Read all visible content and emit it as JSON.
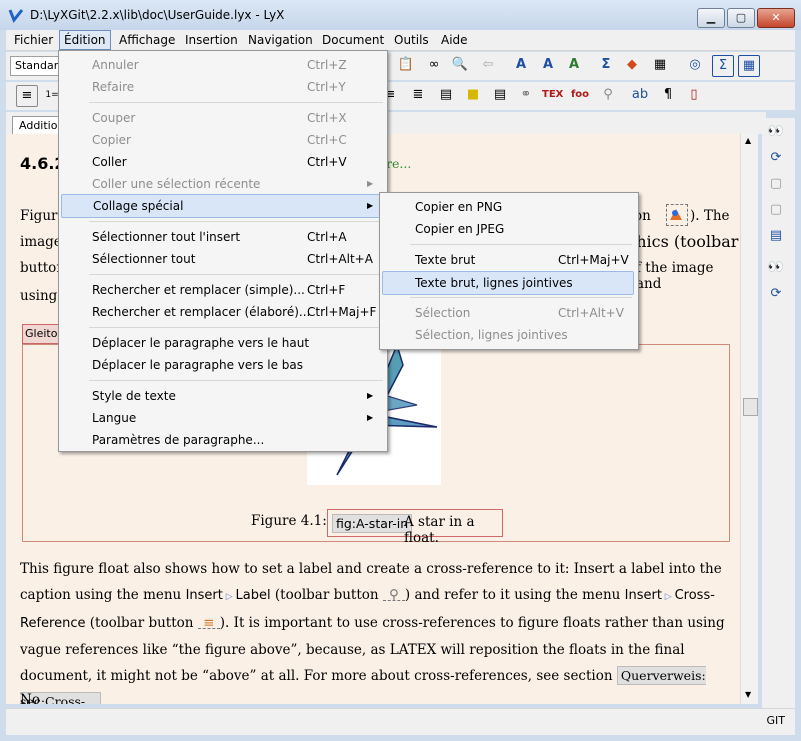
{
  "window": {
    "title": "D:\\LyXGit\\2.2.x\\lib\\doc\\UserGuide.lyx - LyX",
    "min_glyph": "▁",
    "max_glyph": "▢",
    "close_glyph": "✕"
  },
  "menubar": [
    "Fichier",
    "Édition",
    "Affichage",
    "Insertion",
    "Navigation",
    "Document",
    "Outils",
    "Aide"
  ],
  "toolbar": {
    "paragraph_style": "Standard"
  },
  "tab": {
    "label": "Additional"
  },
  "edit_menu": {
    "items": [
      {
        "label": "Annuler",
        "shortcut": "Ctrl+Z"
      },
      {
        "label": "Refaire",
        "shortcut": "Ctrl+Y"
      },
      {
        "label": "Couper",
        "shortcut": "Ctrl+X"
      },
      {
        "label": "Copier",
        "shortcut": "Ctrl+C"
      },
      {
        "label": "Coller",
        "shortcut": "Ctrl+V"
      },
      {
        "label": "Coller une sélection récente",
        "shortcut": ""
      },
      {
        "label": "Collage spécial",
        "shortcut": ""
      },
      {
        "label": "Sélectionner tout l'insert",
        "shortcut": "Ctrl+A"
      },
      {
        "label": "Sélectionner tout",
        "shortcut": "Ctrl+Alt+A"
      },
      {
        "label": "Rechercher et remplacer (simple)...",
        "shortcut": "Ctrl+F"
      },
      {
        "label": "Rechercher et remplacer (élaboré)...",
        "shortcut": "Ctrl+Maj+F"
      },
      {
        "label": "Déplacer le paragraphe vers le haut",
        "shortcut": ""
      },
      {
        "label": "Déplacer le paragraphe vers le bas",
        "shortcut": ""
      },
      {
        "label": "Style de texte",
        "shortcut": ""
      },
      {
        "label": "Langue",
        "shortcut": ""
      },
      {
        "label": "Paramètres de paragraphe...",
        "shortcut": ""
      }
    ]
  },
  "paste_special_menu": {
    "items": [
      {
        "label": "Copier en PNG",
        "shortcut": ""
      },
      {
        "label": "Copier en JPEG",
        "shortcut": ""
      },
      {
        "label": "Texte brut",
        "shortcut": "Ctrl+Maj+V"
      },
      {
        "label": "Texte brut, lignes jointives",
        "shortcut": ""
      },
      {
        "label": "Sélection",
        "shortcut": "Ctrl+Alt+V"
      },
      {
        "label": "Sélection, lignes jointives",
        "shortcut": ""
      }
    ]
  },
  "document": {
    "section_number": "4.6.2",
    "figure_ref_fragment": "igure...",
    "left_fragments": [
      "Figure",
      "image",
      "button",
      "using t"
    ],
    "right_fragments": [
      "on",
      "). The",
      "phics (toolbar",
      "f the image and"
    ],
    "float_label": "Gleitob",
    "caption_prefix": "Figure 4.1:",
    "caption_label": "fig:A-star-in",
    "caption_text": "A star in a float.",
    "para1_a": "This figure float also shows how to set a label and create a cross-reference to it: Insert a label into the caption using the menu",
    "menu_insert": "Insert",
    "menu_label": "Label",
    "para1_b": "(toolbar button",
    "para1_c": ") and refer to it using the menu",
    "menu_cross": "Cross-Reference",
    "para1_d": "(toolbar button",
    "para1_e": "). It is important to use cross-references to figure floats rather than using vague references like “the figure above”, because, as",
    "latex": "LATEX",
    "para1_f": "will reposition the floats in the final document, it might not be “above” at all. For more about cross-references, see section",
    "crossref": "Querverweis: sec:Cross-...",
    "para1_end": ".",
    "para2": "No"
  },
  "status": {
    "vcs": "GIT"
  }
}
